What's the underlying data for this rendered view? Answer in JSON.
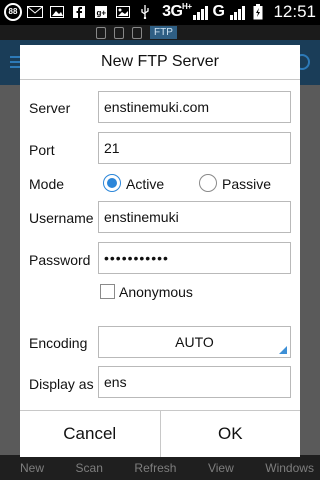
{
  "status_bar": {
    "notification_badge": "88",
    "network_type": "3G",
    "network_sub": "H+",
    "carrier_mark": "G",
    "time": "12:51"
  },
  "app": {
    "strip_label": "FTP",
    "bottom_tabs": [
      "New",
      "Scan",
      "Refresh",
      "View",
      "Windows"
    ]
  },
  "dialog": {
    "title": "New FTP Server",
    "server_label": "Server",
    "server_value": "enstinemuki.com",
    "port_label": "Port",
    "port_value": "21",
    "mode_label": "Mode",
    "mode_options": [
      "Active",
      "Passive"
    ],
    "mode_selected": "Active",
    "username_label": "Username",
    "username_value": "enstinemuki",
    "password_label": "Password",
    "password_value": "•••••••••••",
    "anonymous_label": "Anonymous",
    "anonymous_checked": false,
    "encoding_label": "Encoding",
    "encoding_value": "AUTO",
    "display_as_label": "Display as",
    "display_as_value": "ens",
    "cancel_label": "Cancel",
    "ok_label": "OK"
  },
  "colors": {
    "accent": "#2b86d9",
    "app_bar": "#1a3d58",
    "dim_background": "#5a5a5a"
  }
}
